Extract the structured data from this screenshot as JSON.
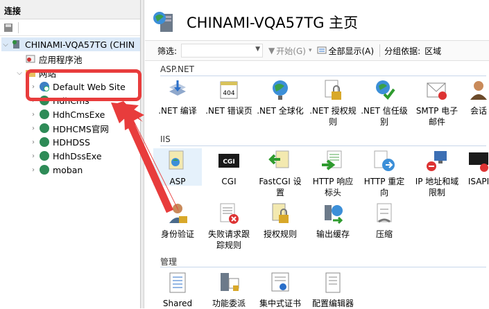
{
  "left": {
    "header": "连接",
    "tree": [
      {
        "label": "CHINAMI-VQA57TG (CHIN",
        "icon": "server-icon"
      },
      {
        "label": "应用程序池",
        "icon": "app-pool-icon"
      },
      {
        "label": "网站",
        "icon": "folder-icon"
      },
      {
        "label": "Default Web Site",
        "icon": "globe-icon"
      },
      {
        "label": "HdhCms",
        "icon": "globe-icon"
      },
      {
        "label": "HdhCmsExe",
        "icon": "globe-icon"
      },
      {
        "label": "HDHCMS官网",
        "icon": "globe-icon"
      },
      {
        "label": "HDHDSS",
        "icon": "globe-icon"
      },
      {
        "label": "HdhDssExe",
        "icon": "globe-icon"
      },
      {
        "label": "moban",
        "icon": "globe-icon"
      }
    ]
  },
  "main": {
    "title": "CHINAMI-VQA57TG 主页",
    "filter": {
      "label": "筛选:",
      "start": "开始(G)",
      "show_all": "全部显示(A)",
      "group_label": "分组依据:",
      "group_value": "区域"
    },
    "sections": {
      "aspnet": "ASP.NET",
      "iis": "IIS",
      "manage": "管理"
    },
    "aspnet_items": [
      ".NET 编译",
      ".NET 错误页",
      ".NET 全球化",
      ".NET 授权规则",
      ".NET 信任级别",
      "SMTP 电子邮件",
      "会话"
    ],
    "iis_items": [
      "ASP",
      "CGI",
      "FastCGI 设置",
      "HTTP 响应标头",
      "HTTP 重定向",
      "IP 地址和域限制",
      "ISAPI"
    ],
    "iis_items2": [
      "身份验证",
      "失败请求跟踪规则",
      "授权规则",
      "输出缓存",
      "压缩"
    ],
    "manage_items": [
      "Shared",
      "功能委派",
      "集中式证书",
      "配置编辑器"
    ],
    "error_page_code": "404",
    "cgi_text": "CGI"
  },
  "colors": {
    "annotation": "#e83c3c",
    "section_line": "#c7d6ea",
    "selection": "#dbe9f8"
  }
}
